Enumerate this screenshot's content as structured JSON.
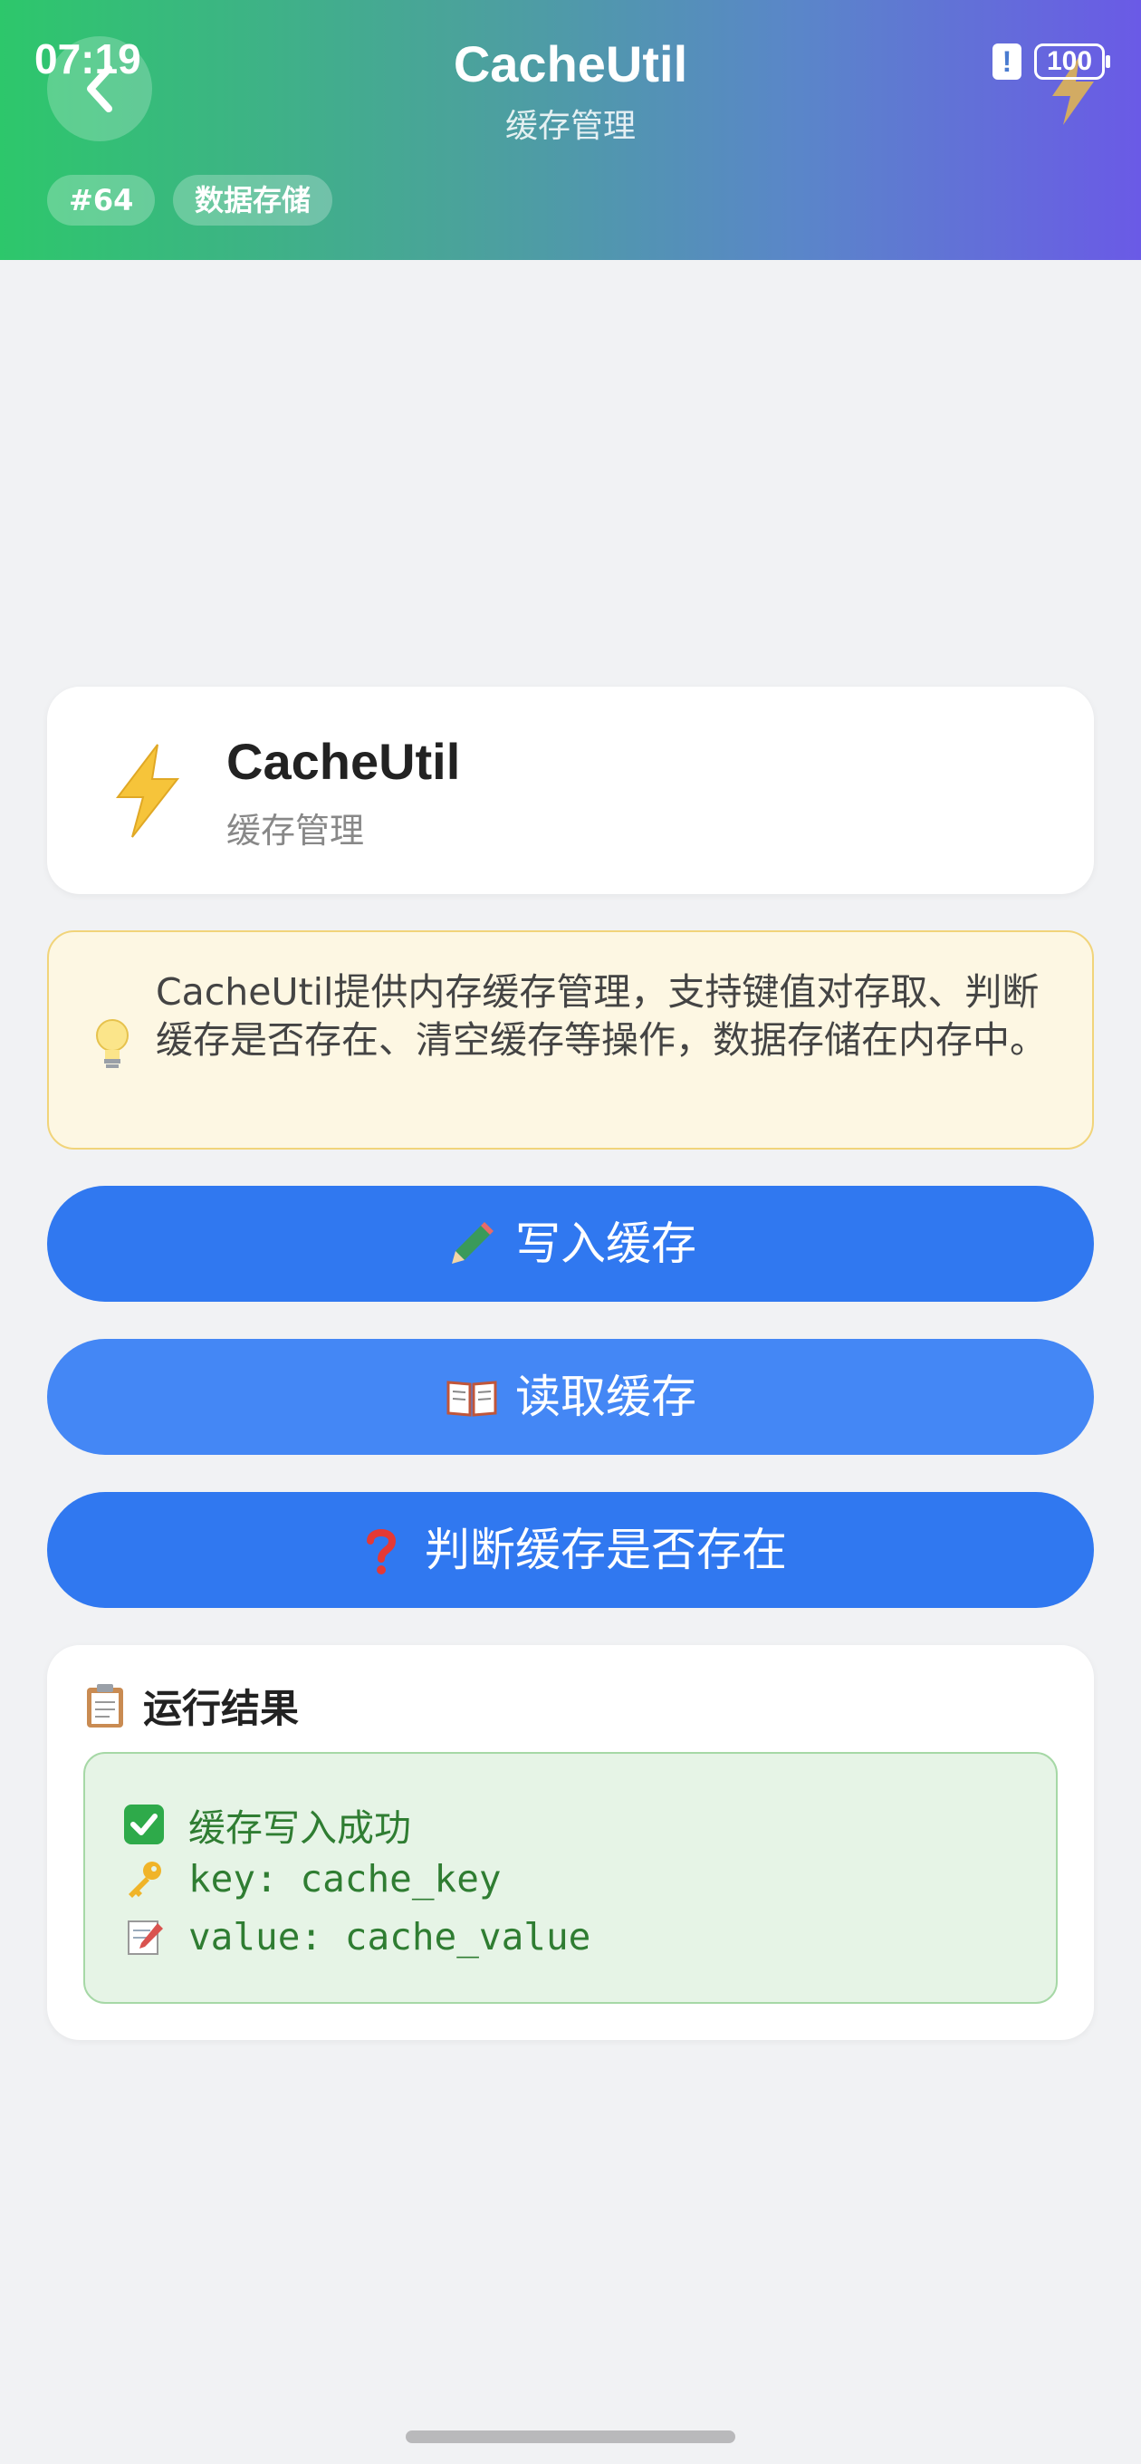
{
  "status_bar": {
    "time": "07:19",
    "battery": "100",
    "alert": "!"
  },
  "header": {
    "title": "CacheUtil",
    "subtitle": "缓存管理",
    "tags": [
      "#64",
      "数据存储"
    ]
  },
  "intro": {
    "title": "CacheUtil",
    "subtitle": "缓存管理",
    "icon": "lightning-icon"
  },
  "tip": {
    "icon": "lightbulb-icon",
    "text": "CacheUtil提供内存缓存管理，支持键值对存取、判断缓存是否存在、清空缓存等操作，数据存储在内存中。"
  },
  "buttons": {
    "write": {
      "icon": "pencil-icon",
      "label": "写入缓存"
    },
    "read": {
      "icon": "book-icon",
      "label": "读取缓存"
    },
    "exists": {
      "icon": "question-icon",
      "label": "判断缓存是否存在"
    }
  },
  "result": {
    "title": "运行结果",
    "icon": "clipboard-icon",
    "lines": [
      {
        "icon": "check-icon",
        "text": "缓存写入成功"
      },
      {
        "icon": "key-icon",
        "text": "key: cache_key"
      },
      {
        "icon": "memo-icon",
        "text": "value: cache_value"
      }
    ]
  },
  "colors": {
    "primary_button": "#3078f0",
    "header_gradient_start": "#2dc76b",
    "header_gradient_end": "#6a5ae6",
    "success_text": "#2f7d32"
  }
}
